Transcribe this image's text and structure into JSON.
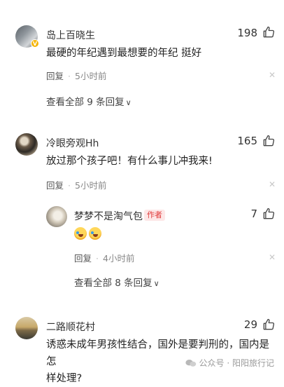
{
  "comments": [
    {
      "user": "岛上百晓生",
      "likes": "198",
      "text": "最硬的年纪遇到最想要的年纪 挺好",
      "reply_label": "回复",
      "time": "5小时前",
      "view_all": "查看全部 9 条回复"
    },
    {
      "user": "冷眼旁观Hh",
      "likes": "165",
      "text": "放过那个孩子吧！有什么事儿冲我来!",
      "reply_label": "回复",
      "time": "5小时前",
      "reply": {
        "user": "梦梦不是淘气包",
        "author_tag": "作者",
        "likes": "7",
        "reply_label": "回复",
        "time": "4小时前"
      },
      "view_all": "查看全部 8 条回复"
    },
    {
      "user": "二路顺花村",
      "likes": "29",
      "text_line1": "诱惑未成年男孩性结合，国外是要判刑的，国内是怎",
      "text_line2": "样处理?"
    }
  ],
  "watermark": "公众号 · 阳阳旅行记",
  "icons": {
    "like": "thumbs-up-icon",
    "close": "close-icon",
    "chevron": "chevron-down-icon",
    "verified": "verified-badge-icon"
  }
}
